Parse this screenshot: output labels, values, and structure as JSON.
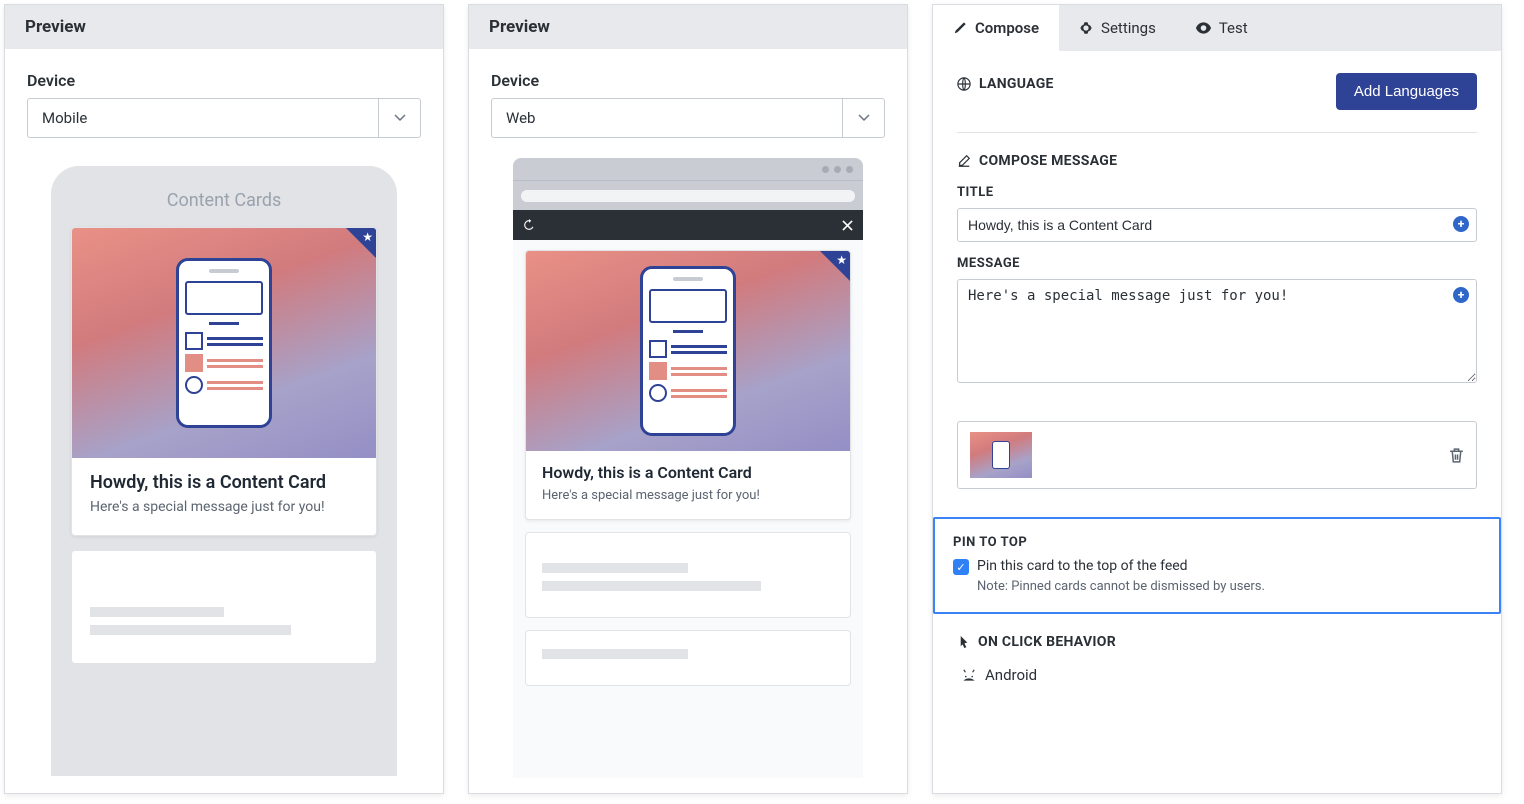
{
  "left": {
    "header": "Preview",
    "deviceLabel": "Device",
    "deviceValue": "Mobile",
    "phoneTitle": "Content Cards",
    "cardTitle": "Howdy, this is a Content Card",
    "cardMsg": "Here's a special message just for you!"
  },
  "mid": {
    "header": "Preview",
    "deviceLabel": "Device",
    "deviceValue": "Web",
    "cardTitle": "Howdy, this is a Content Card",
    "cardMsg": "Here's a special message just for you!"
  },
  "right": {
    "tabs": {
      "compose": "Compose",
      "settings": "Settings",
      "test": "Test"
    },
    "language": "LANGUAGE",
    "addLang": "Add Languages",
    "composeHead": "COMPOSE MESSAGE",
    "titleLabel": "TITLE",
    "titleValue": "Howdy, this is a Content Card",
    "msgLabel": "MESSAGE",
    "msgValue": "Here's a special message just for you!",
    "pinHead": "PIN TO TOP",
    "pinCheckLabel": "Pin this card to the top of the feed",
    "pinNote": "Note: Pinned cards cannot be dismissed by users.",
    "clickHead": "ON CLICK BEHAVIOR",
    "android": "Android"
  }
}
